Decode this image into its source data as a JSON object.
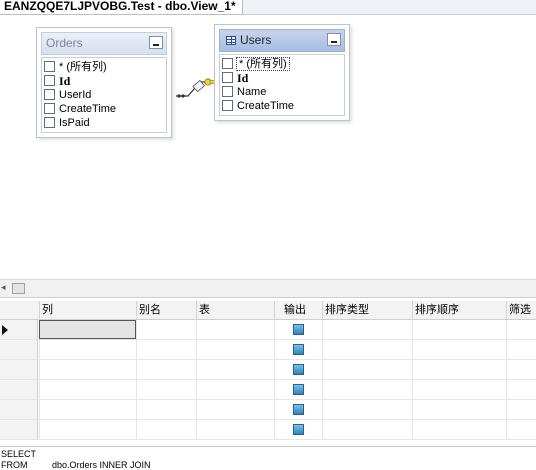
{
  "tab": {
    "title": "EANZQQE7LJPVOBG.Test - dbo.View_1*"
  },
  "tables": {
    "orders": {
      "title": "Orders",
      "columns": [
        "* (所有列)",
        "Id",
        "UserId",
        "CreateTime",
        "IsPaid"
      ]
    },
    "users": {
      "title": "Users",
      "columns": [
        "* (所有列)",
        "Id",
        "Name",
        "CreateTime"
      ]
    }
  },
  "criteria": {
    "headers": [
      "列",
      "别名",
      "表",
      "输出",
      "排序类型",
      "排序顺序",
      "筛选"
    ],
    "rows": [
      {
        "output": true
      },
      {
        "output": true
      },
      {
        "output": true
      },
      {
        "output": true
      },
      {
        "output": true
      },
      {
        "output": true
      }
    ]
  },
  "sql": {
    "line1": "SELECT",
    "line2_keyword": "FROM",
    "line2_text": "dbo.Orders INNER JOIN"
  },
  "colors": {
    "active_header": "#a9bde0",
    "output_checkbox": "#2f83bd"
  }
}
